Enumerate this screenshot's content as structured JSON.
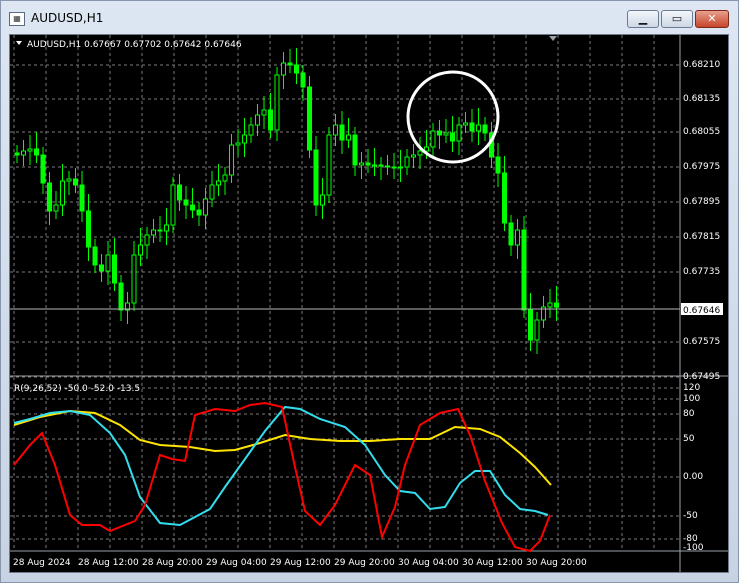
{
  "window": {
    "title": "AUDUSD,H1",
    "title_icon": "chart-window-icon"
  },
  "controls": {
    "minimize_icon": "minimize-icon",
    "maximize_icon": "maximize-icon",
    "close_icon": "close-icon"
  },
  "main": {
    "header": "AUDUSD,H1  0.67667 0.67702 0.67642 0.67646",
    "current_price": "0.67646",
    "price_ticks": [
      "0.68210",
      "0.68135",
      "0.68055",
      "0.67975",
      "0.67895",
      "0.67815",
      "0.67735",
      "0.67575",
      "0.67495"
    ],
    "candle_color": "#00ff00",
    "highlight_color": "#ffffff"
  },
  "indicator": {
    "header": "R(9,26,52) -50.0 -52.0 -13.5",
    "ticks": [
      "120",
      "100",
      "80",
      "50",
      "0.00",
      "-50",
      "-80",
      "-100"
    ],
    "colors": {
      "red": "#ff0000",
      "cyan": "#33ddee",
      "yellow": "#ffe400"
    }
  },
  "time_axis": [
    "28 Aug 2024",
    "28 Aug 12:00",
    "28 Aug 20:00",
    "29 Aug 04:00",
    "29 Aug 12:00",
    "29 Aug 20:00",
    "30 Aug 04:00",
    "30 Aug 12:00",
    "30 Aug 20:00"
  ]
}
